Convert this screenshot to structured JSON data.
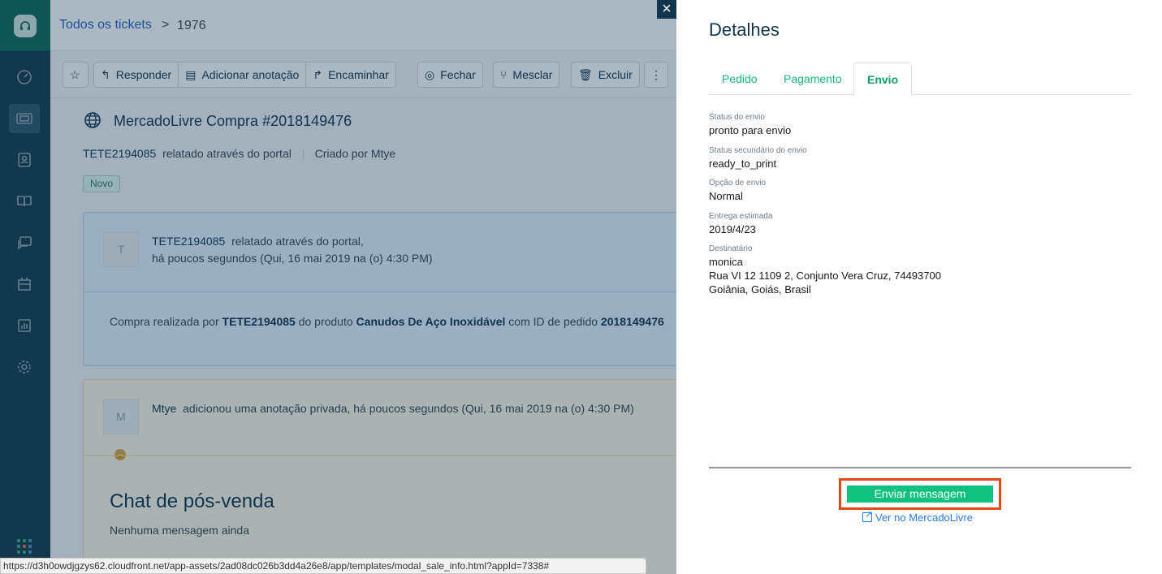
{
  "breadcrumb": {
    "link": "Todos os tickets",
    "separator": ">",
    "ticket_id": "1976"
  },
  "toolbar": {
    "reply": "Responder",
    "add_note": "Adicionar anotação",
    "forward": "Encaminhar",
    "close": "Fechar",
    "merge": "Mesclar",
    "delete": "Excluir"
  },
  "ticket": {
    "title": "MercadoLivre Compra #2018149476",
    "requester": "TETE2194085",
    "reported_via": "relatado através do portal",
    "created_by": "Criado por Mtye",
    "status": "Novo"
  },
  "conversation1": {
    "avatar": "T",
    "author": "TETE2194085",
    "action": "relatado através do portal,",
    "time": "há poucos segundos (Qui, 16 mai 2019 na (o) 4:30 PM)",
    "body_prefix": "Compra realizada por",
    "buyer": "TETE2194085",
    "body_mid": "do produto",
    "product": "Canudos De Aço Inoxidável",
    "body_suffix": "com ID de pedido",
    "order_id": "2018149476"
  },
  "conversation2": {
    "avatar": "M",
    "author": "Mtye",
    "action": "adicionou uma anotação privada, há poucos segundos (Qui, 16 mai 2019 na (o) 4:30 PM)",
    "chat_title": "Chat de pós-venda",
    "chat_empty": "Nenhuma mensagem ainda"
  },
  "panel": {
    "close": "×",
    "title": "Detalhes",
    "tabs": [
      "Pedido",
      "Pagamento",
      "Envio"
    ],
    "active_tab": "Envio",
    "fields": [
      {
        "label": "Status do envio",
        "value": "pronto para envio"
      },
      {
        "label": "Status secundário do envio",
        "value": "ready_to_print"
      },
      {
        "label": "Opção de envio",
        "value": "Normal"
      },
      {
        "label": "Entrega estimada",
        "value": "2019/4/23"
      },
      {
        "label": "Destinatário",
        "value": "monica"
      }
    ],
    "address_line1": "Rua VI 12 1109 2, Conjunto Vera Cruz, 74493700",
    "address_line2": "Goiânia, Goiás, Brasil",
    "send_button": "Enviar mensagem",
    "view_link": "Ver no MercadoLivre"
  },
  "status_url": "https://d3h0owdjgzys62.cloudfront.net/app-assets/2ad08dc026b3dd4a26e8/app/templates/modal_sale_info.html?appId=7338#",
  "colors": {
    "accent": "#10c27f",
    "highlight": "#e04a16",
    "sidebar": "#153a4c",
    "link": "#2c5cc5"
  }
}
